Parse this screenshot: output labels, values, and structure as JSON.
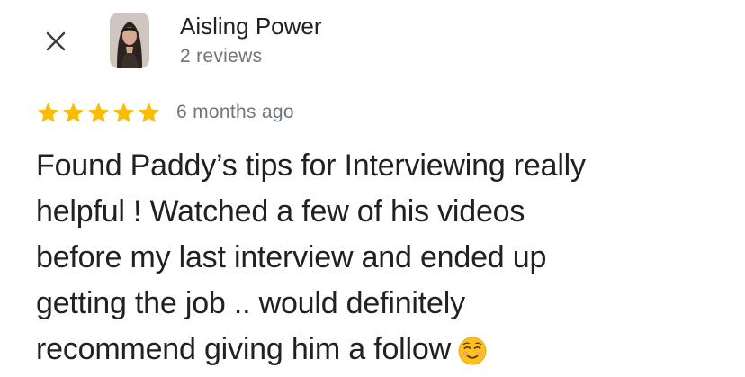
{
  "header": {
    "close_icon": "close-icon",
    "author_name": "Aisling Power",
    "author_meta": "2 reviews",
    "avatar": "avatar-photo"
  },
  "rating": {
    "stars": 5,
    "max_stars": 5,
    "star_color": "#fbbc04",
    "date": "6 months ago"
  },
  "review": {
    "lines": [
      "Found Paddy’s tips for Interviewing really",
      "helpful ! Watched a few of his videos",
      "before my last interview and ended up",
      "getting the job .. would definitely",
      "recommend giving him a follow"
    ],
    "trailing_emoji": "smiling-face-emoji"
  },
  "colors": {
    "text_primary": "#202124",
    "text_secondary": "#70757a",
    "background": "#ffffff"
  }
}
